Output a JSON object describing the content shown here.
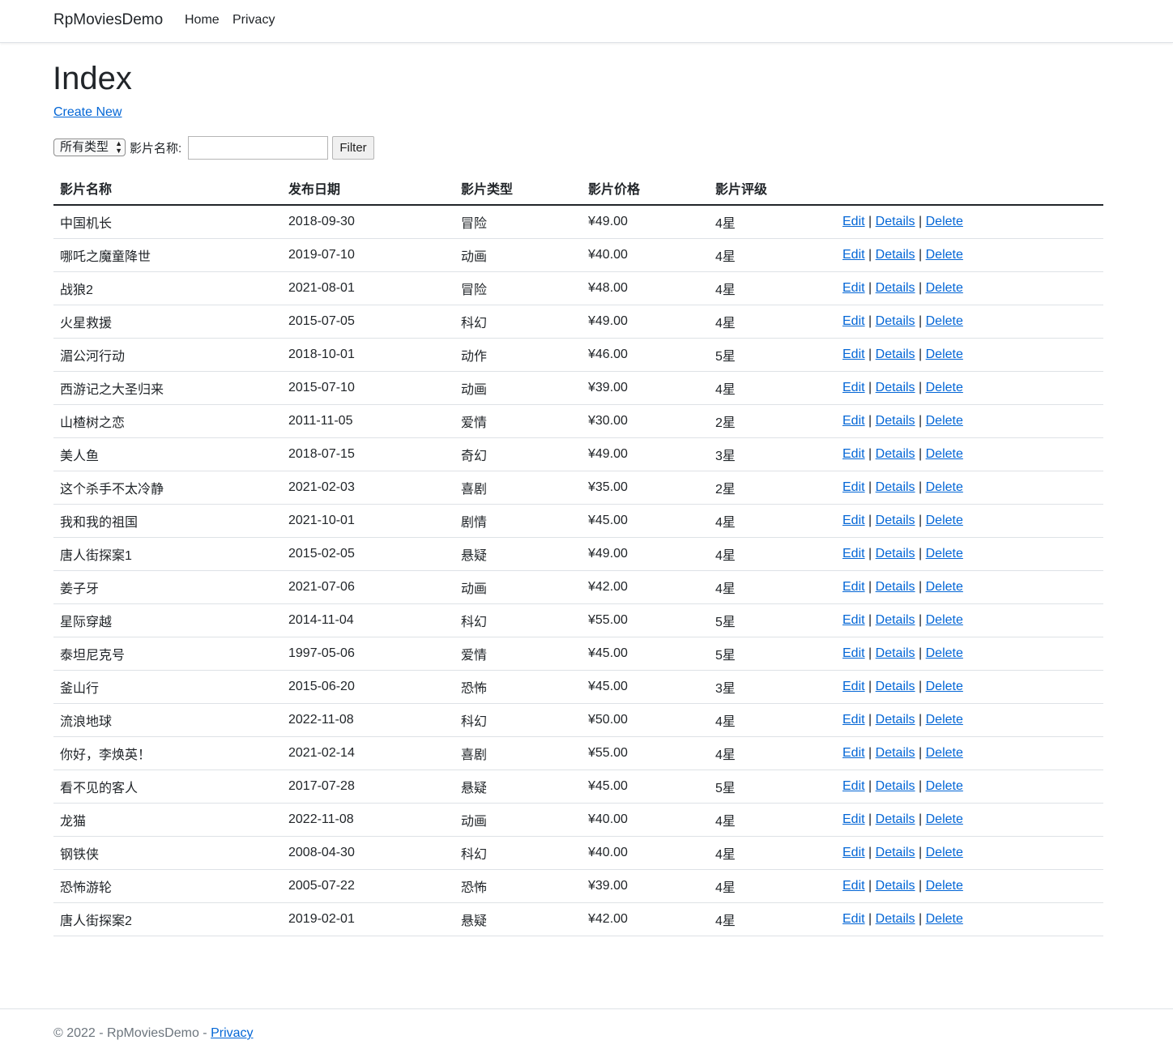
{
  "navbar": {
    "brand": "RpMoviesDemo",
    "links": [
      {
        "label": "Home"
      },
      {
        "label": "Privacy"
      }
    ]
  },
  "page": {
    "title": "Index",
    "create_link": "Create New"
  },
  "filter": {
    "type_select_value": "所有类型",
    "name_label": "影片名称:",
    "name_value": "",
    "button_label": "Filter"
  },
  "table": {
    "headers": [
      "影片名称",
      "发布日期",
      "影片类型",
      "影片价格",
      "影片评级"
    ],
    "action_labels": {
      "edit": "Edit",
      "details": "Details",
      "delete": "Delete",
      "separator": "|"
    },
    "rows": [
      [
        "中国机长",
        "2018-09-30",
        "冒险",
        "¥49.00",
        "4星"
      ],
      [
        "哪吒之魔童降世",
        "2019-07-10",
        "动画",
        "¥40.00",
        "4星"
      ],
      [
        "战狼2",
        "2021-08-01",
        "冒险",
        "¥48.00",
        "4星"
      ],
      [
        "火星救援",
        "2015-07-05",
        "科幻",
        "¥49.00",
        "4星"
      ],
      [
        "湄公河行动",
        "2018-10-01",
        "动作",
        "¥46.00",
        "5星"
      ],
      [
        "西游记之大圣归来",
        "2015-07-10",
        "动画",
        "¥39.00",
        "4星"
      ],
      [
        "山楂树之恋",
        "2011-11-05",
        "爱情",
        "¥30.00",
        "2星"
      ],
      [
        "美人鱼",
        "2018-07-15",
        "奇幻",
        "¥49.00",
        "3星"
      ],
      [
        "这个杀手不太冷静",
        "2021-02-03",
        "喜剧",
        "¥35.00",
        "2星"
      ],
      [
        "我和我的祖国",
        "2021-10-01",
        "剧情",
        "¥45.00",
        "4星"
      ],
      [
        "唐人街探案1",
        "2015-02-05",
        "悬疑",
        "¥49.00",
        "4星"
      ],
      [
        "姜子牙",
        "2021-07-06",
        "动画",
        "¥42.00",
        "4星"
      ],
      [
        "星际穿越",
        "2014-11-04",
        "科幻",
        "¥55.00",
        "5星"
      ],
      [
        "泰坦尼克号",
        "1997-05-06",
        "爱情",
        "¥45.00",
        "5星"
      ],
      [
        "釜山行",
        "2015-06-20",
        "恐怖",
        "¥45.00",
        "3星"
      ],
      [
        "流浪地球",
        "2022-11-08",
        "科幻",
        "¥50.00",
        "4星"
      ],
      [
        "你好，李焕英！",
        "2021-02-14",
        "喜剧",
        "¥55.00",
        "4星"
      ],
      [
        "看不见的客人",
        "2017-07-28",
        "悬疑",
        "¥45.00",
        "5星"
      ],
      [
        "龙猫",
        "2022-11-08",
        "动画",
        "¥40.00",
        "4星"
      ],
      [
        "钢铁侠",
        "2008-04-30",
        "科幻",
        "¥40.00",
        "4星"
      ],
      [
        "恐怖游轮",
        "2005-07-22",
        "恐怖",
        "¥39.00",
        "4星"
      ],
      [
        "唐人街探案2",
        "2019-02-01",
        "悬疑",
        "¥42.00",
        "4星"
      ]
    ]
  },
  "footer": {
    "text": "© 2022 - RpMoviesDemo - ",
    "privacy_link": "Privacy"
  },
  "colors": {
    "link": "#0366d6",
    "text": "#212529",
    "muted": "#6c757d",
    "border": "#dee2e6"
  }
}
